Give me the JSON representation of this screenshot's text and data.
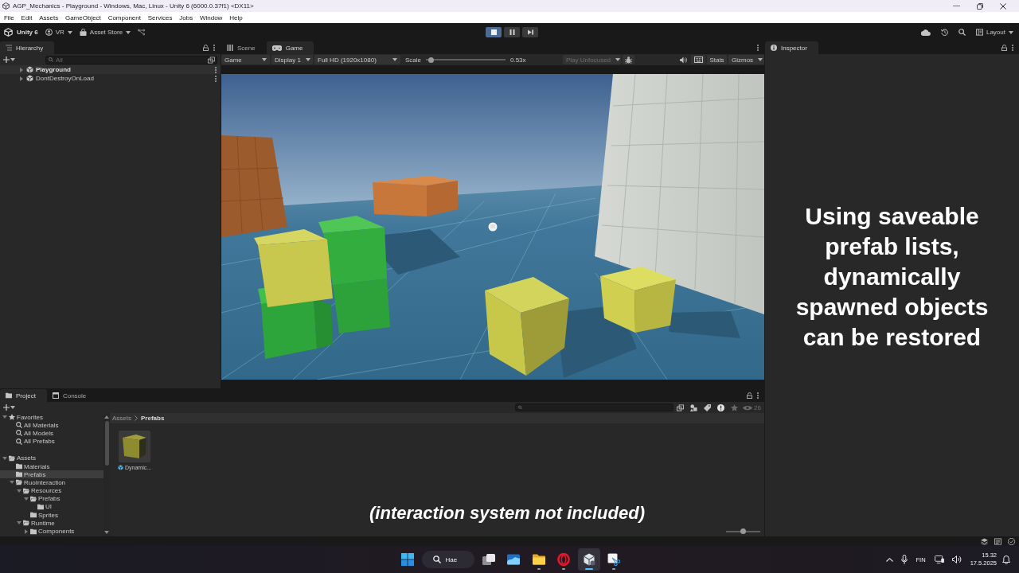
{
  "window": {
    "title": "AGP_Mechanics - Playground - Windows, Mac, Linux - Unity 6 (6000.0.37f1) <DX11>"
  },
  "menu": [
    "File",
    "Edit",
    "Assets",
    "GameObject",
    "Component",
    "Services",
    "Jobs",
    "Window",
    "Help"
  ],
  "toolbar": {
    "account": "Unity 6",
    "vr": "VR",
    "asset_store": "Asset Store",
    "playing": true,
    "paused": false,
    "layout": "Layout"
  },
  "hierarchy": {
    "tab": "Hierarchy",
    "search": {
      "placeholder": "All"
    },
    "items": [
      {
        "label": "Playground",
        "active": true,
        "expanded": false
      },
      {
        "label": "DontDestroyOnLoad",
        "active": false,
        "expanded": false
      }
    ]
  },
  "game": {
    "tabs": [
      {
        "label": "Scene",
        "kind": "scene",
        "selected": false
      },
      {
        "label": "Game",
        "kind": "game",
        "selected": true
      }
    ],
    "toolbar": {
      "view": "Game",
      "display": "Display 1",
      "resolution": "Full HD (1920x1080)",
      "scale": {
        "label": "Scale",
        "level": 0.03,
        "reading": "0.53x"
      },
      "focus": {
        "label": "Play Unfocused",
        "disabled": true
      },
      "stats": "Stats",
      "gizmos": "Gizmos"
    }
  },
  "inspector": {
    "tab": "Inspector",
    "caption": "Using saveable prefab lists, dynamically spawned objects can be restored"
  },
  "project": {
    "tabs": [
      {
        "label": "Project",
        "kind": "project",
        "selected": true
      },
      {
        "label": "Console",
        "kind": "console",
        "selected": false
      }
    ],
    "filter_count": "26",
    "tree": [
      {
        "label": "Favorites",
        "kind": "favorites",
        "expanded": true,
        "selected": false,
        "children": [
          {
            "label": "All Materials",
            "kind": "search",
            "selected": false
          },
          {
            "label": "All Models",
            "kind": "search",
            "selected": false
          },
          {
            "label": "All Prefabs",
            "kind": "search",
            "selected": false
          }
        ]
      },
      {
        "label": "Assets",
        "kind": "folder",
        "expanded": true,
        "selected": false,
        "children": [
          {
            "label": "Materials",
            "kind": "folder",
            "selected": false
          },
          {
            "label": "Prefabs",
            "kind": "folder",
            "selected": true
          },
          {
            "label": "RuoInteraction",
            "kind": "folder",
            "expanded": true,
            "selected": false,
            "children": [
              {
                "label": "Resources",
                "kind": "folder",
                "expanded": true,
                "selected": false,
                "children": [
                  {
                    "label": "Prefabs",
                    "kind": "folder",
                    "expanded": true,
                    "selected": false,
                    "children": [
                      {
                        "label": "UI",
                        "kind": "folder",
                        "selected": false
                      }
                    ]
                  },
                  {
                    "label": "Sprites",
                    "kind": "folder",
                    "selected": false
                  }
                ]
              },
              {
                "label": "Runtime",
                "kind": "folder",
                "expanded": true,
                "selected": false,
                "children": [
                  {
                    "label": "Components",
                    "kind": "folder",
                    "expanded": false,
                    "selected": false
                  }
                ]
              }
            ]
          }
        ]
      }
    ],
    "breadcrumb": [
      "Assets",
      "Prefabs"
    ],
    "assets": [
      {
        "label": "Dynamic...",
        "kind": "prefab"
      }
    ],
    "icon_size": {
      "level": 0.5
    },
    "caption": "(interaction system not included)"
  },
  "taskbar": {
    "search": "Hae",
    "apps": [
      {
        "kind": "task-view",
        "running": false,
        "selected": false
      },
      {
        "kind": "image",
        "running": false,
        "selected": false
      },
      {
        "kind": "folder",
        "running": true,
        "selected": false
      },
      {
        "kind": "ring",
        "running": true,
        "selected": false
      },
      {
        "kind": "cube",
        "running": true,
        "selected": true
      },
      {
        "kind": "scissors",
        "running": true,
        "selected": false
      }
    ],
    "language": "FIN",
    "time": "15.32",
    "date": "17.5.2025"
  }
}
